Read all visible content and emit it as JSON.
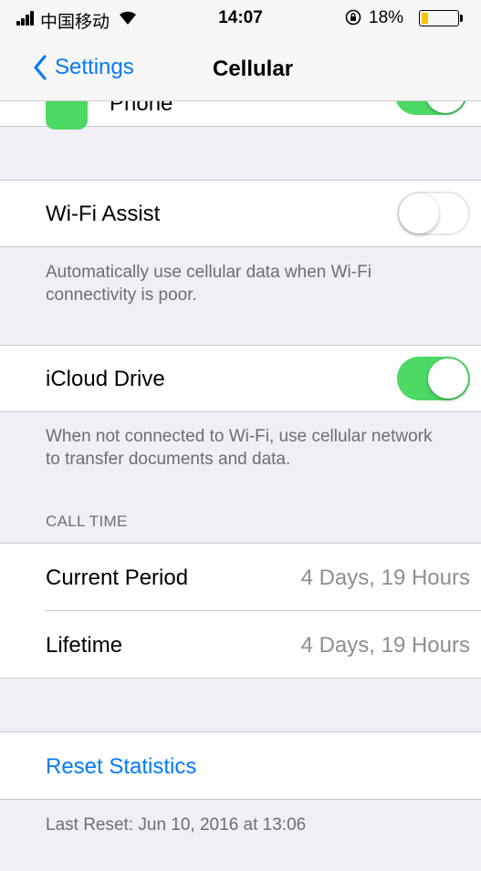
{
  "status_bar": {
    "carrier": "中国移动",
    "time": "14:07",
    "battery_percent": "18%",
    "battery_level": 0.18,
    "icons": [
      "signal-icon",
      "wifi-icon",
      "rotation-lock-icon",
      "battery-icon"
    ]
  },
  "nav": {
    "back_label": "Settings",
    "title": "Cellular"
  },
  "phone_row": {
    "label": "Phone",
    "toggle_on": true
  },
  "wifi_assist": {
    "label": "Wi-Fi Assist",
    "toggle_on": false,
    "footer": "Automatically use cellular data when Wi-Fi connectivity is poor."
  },
  "icloud_drive": {
    "label": "iCloud Drive",
    "toggle_on": true,
    "footer": "When not connected to Wi-Fi, use cellular network to transfer documents and data."
  },
  "call_time": {
    "header": "CALL TIME",
    "rows": [
      {
        "label": "Current Period",
        "value": "4 Days, 19 Hours"
      },
      {
        "label": "Lifetime",
        "value": "4 Days, 19 Hours"
      }
    ]
  },
  "reset": {
    "label": "Reset Statistics",
    "footer": "Last Reset: Jun 10, 2016 at 13:06"
  },
  "colors": {
    "accent": "#007aff",
    "toggle_on": "#4cd964",
    "background": "#efeff4",
    "battery_low": "#f5c400"
  }
}
